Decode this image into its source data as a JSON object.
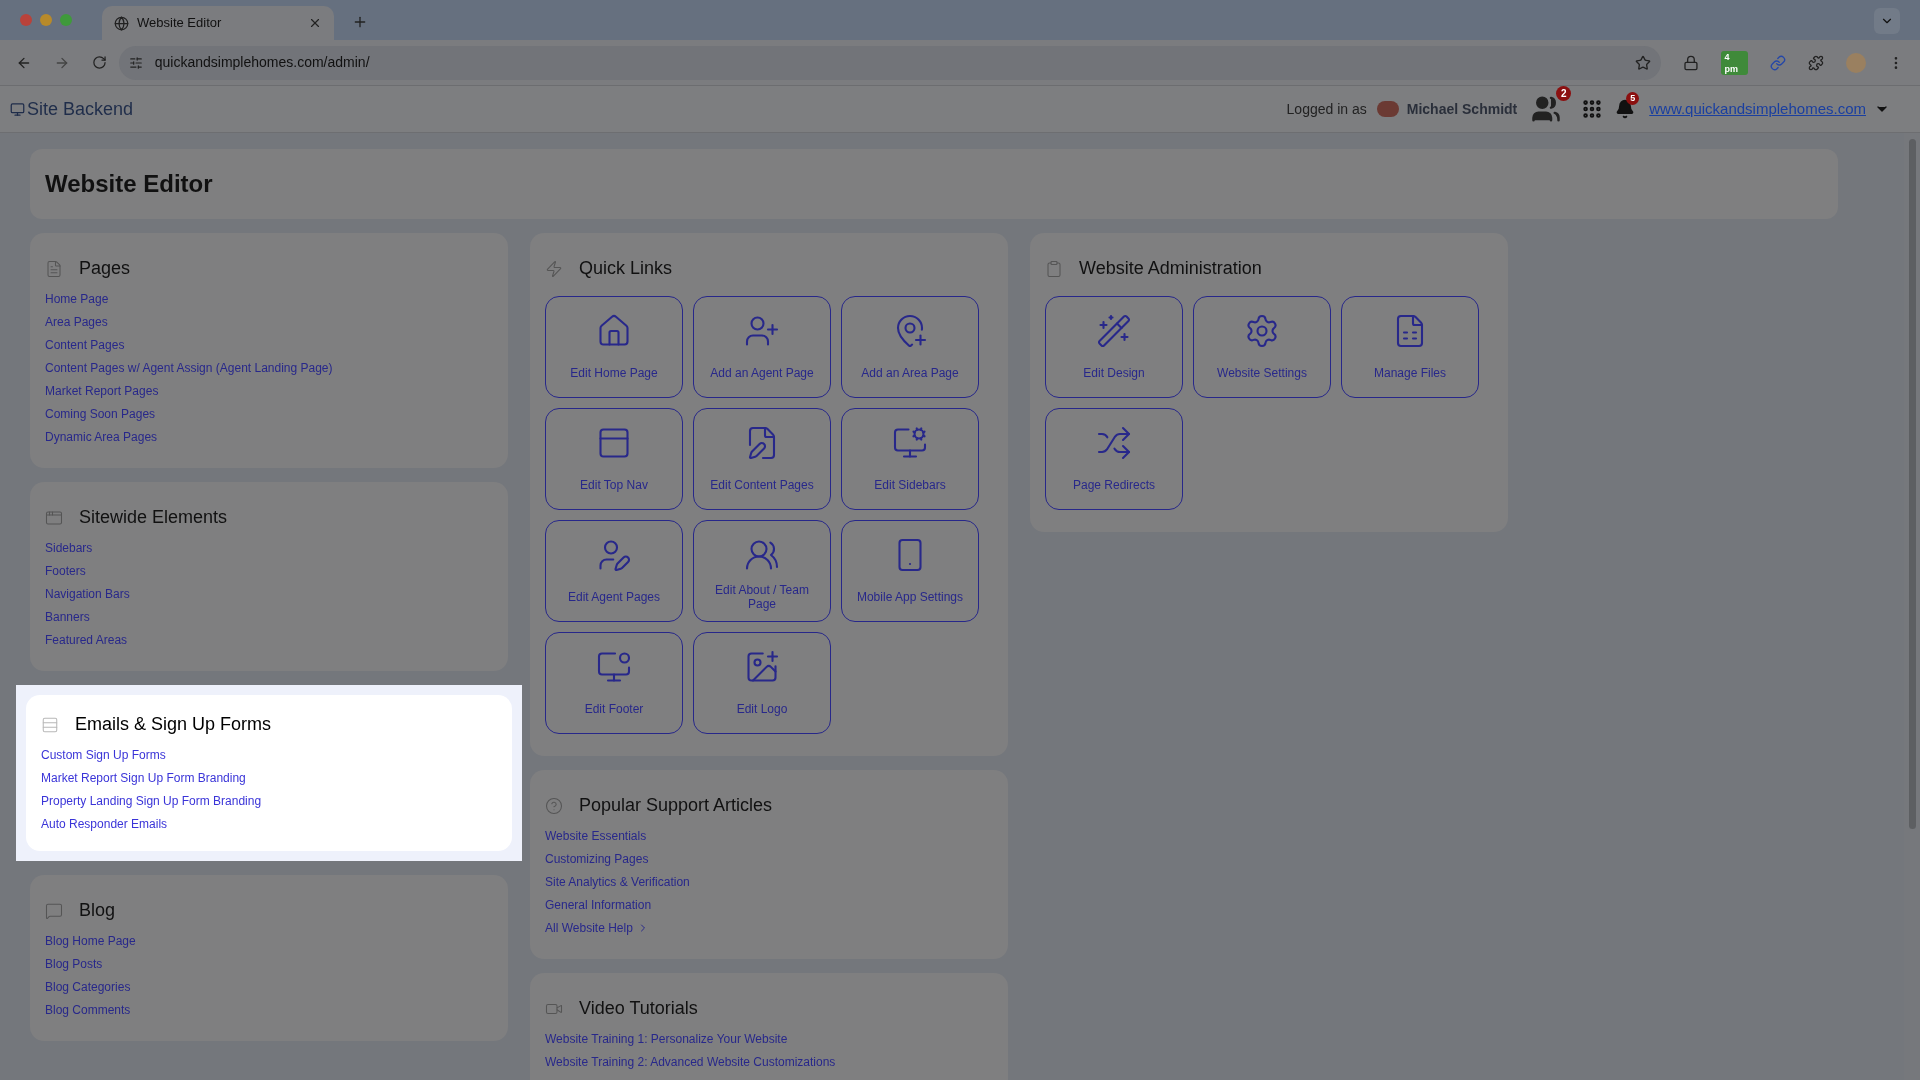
{
  "browser": {
    "tab_title": "Website Editor",
    "url": "quickandsimplehomes.com/admin/",
    "extension_badge": "4 pm"
  },
  "header": {
    "brand": "Site Backend",
    "logged_in_label": "Logged in as",
    "user_name": "Michael Schmidt",
    "team_badge": "2",
    "notification_badge": "5",
    "site_link": "www.quickandsimplehomes.com"
  },
  "page_title": "Website Editor",
  "columns": [
    [
      {
        "kind": "links",
        "title": "Pages",
        "highlighted": false,
        "links": [
          "Home Page",
          "Area Pages",
          "Content Pages",
          "Content Pages w/ Agent Assign (Agent Landing Page)",
          "Market Report Pages",
          "Coming Soon Pages",
          "Dynamic Area Pages"
        ]
      },
      {
        "kind": "links",
        "title": "Sitewide Elements",
        "highlighted": false,
        "links": [
          "Sidebars",
          "Footers",
          "Navigation Bars",
          "Banners",
          "Featured Areas"
        ]
      },
      {
        "kind": "links",
        "title": "Emails & Sign Up Forms",
        "highlighted": true,
        "links": [
          "Custom Sign Up Forms",
          "Market Report Sign Up Form Branding",
          "Property Landing Sign Up Form Branding",
          "Auto Responder Emails"
        ]
      },
      {
        "kind": "links",
        "title": "Blog",
        "highlighted": false,
        "links": [
          "Blog Home Page",
          "Blog Posts",
          "Blog Categories",
          "Blog Comments"
        ]
      }
    ],
    [
      {
        "kind": "tiles",
        "title": "Quick Links",
        "highlighted": false,
        "tiles": [
          "Edit Home Page",
          "Add an Agent Page",
          "Add an Area Page",
          "Edit Top Nav",
          "Edit Content Pages",
          "Edit Sidebars",
          "Edit Agent Pages",
          "Edit About / Team Page",
          "Mobile App Settings",
          "Edit Footer",
          "Edit Logo"
        ]
      },
      {
        "kind": "links",
        "title": "Popular Support Articles",
        "highlighted": false,
        "links": [
          "Website Essentials",
          "Customizing Pages",
          "Site Analytics & Verification",
          "General Information"
        ],
        "more_link": "All Website Help"
      },
      {
        "kind": "links",
        "title": "Video Tutorials",
        "highlighted": false,
        "links": [
          "Website Training 1: Personalize Your Website",
          "Website Training 2: Advanced Website Customizations"
        ]
      }
    ],
    [
      {
        "kind": "tiles",
        "title": "Website Administration",
        "highlighted": false,
        "tiles": [
          "Edit Design",
          "Website Settings",
          "Manage Files",
          "Page Redirects"
        ]
      }
    ]
  ]
}
